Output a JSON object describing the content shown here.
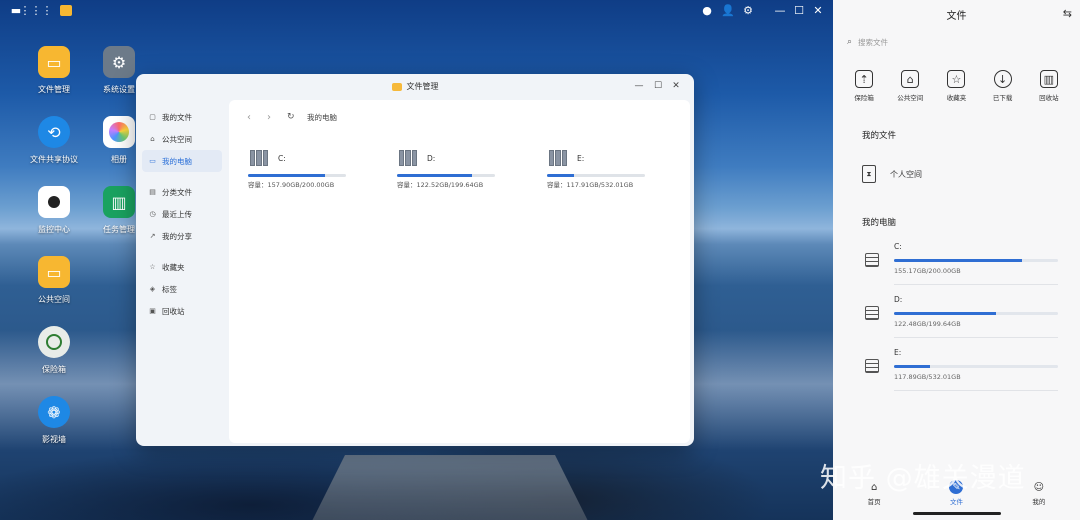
{
  "desktop": {
    "icons": [
      {
        "label": "文件管理",
        "icon": "folder-icon",
        "color": "#f7b731"
      },
      {
        "label": "系统设置",
        "icon": "gear-icon",
        "color": "#6c7a89"
      },
      {
        "label": "文件共享协议",
        "icon": "share-icon",
        "color": "#1e88e5"
      },
      {
        "label": "相册",
        "icon": "photos-icon",
        "color": "#ffffff"
      },
      {
        "label": "监控中心",
        "icon": "camera-icon",
        "color": "#ffffff"
      },
      {
        "label": "任务管理",
        "icon": "task-icon",
        "color": "#1aa260"
      },
      {
        "label": "公共空间",
        "icon": "public-folder-icon",
        "color": "#f7b731"
      },
      {
        "label": "保险箱",
        "icon": "safe-icon",
        "color": "#e8ece8"
      },
      {
        "label": "影视墙",
        "icon": "video-icon",
        "color": "#1e88e5"
      }
    ]
  },
  "window": {
    "title": "文件管理",
    "sidebar": [
      {
        "label": "我的文件",
        "icon": "my-files-icon"
      },
      {
        "label": "公共空间",
        "icon": "public-space-icon"
      },
      {
        "label": "我的电脑",
        "icon": "computer-icon",
        "active": true
      },
      {
        "label": "分类文件",
        "icon": "category-icon"
      },
      {
        "label": "最近上传",
        "icon": "recent-upload-icon"
      },
      {
        "label": "我的分享",
        "icon": "share-icon"
      },
      {
        "label": "收藏夹",
        "icon": "star-icon"
      },
      {
        "label": "标签",
        "icon": "tag-icon"
      },
      {
        "label": "回收站",
        "icon": "trash-icon"
      }
    ],
    "path": "我的电脑",
    "drives": [
      {
        "name": "C:",
        "capacity": "容量：157.90GB/200.00GB",
        "fraction": 0.79
      },
      {
        "name": "D:",
        "capacity": "容量：122.52GB/199.64GB",
        "fraction": 0.77
      },
      {
        "name": "E:",
        "capacity": "容量：117.91GB/532.01GB",
        "fraction": 0.28
      }
    ]
  },
  "panel": {
    "title": "文件",
    "search_placeholder": "搜索文件",
    "quick": [
      {
        "label": "保险箱",
        "icon": "safe-icon"
      },
      {
        "label": "公共空间",
        "icon": "public-folder-icon"
      },
      {
        "label": "收藏夹",
        "icon": "favorites-icon"
      },
      {
        "label": "已下载",
        "icon": "download-icon"
      },
      {
        "label": "回收站",
        "icon": "trash-icon"
      }
    ],
    "my_files_title": "我的文件",
    "personal_space": "个人空间",
    "my_computer_title": "我的电脑",
    "drives": [
      {
        "name": "C:",
        "capacity": "155.17GB/200.00GB",
        "fraction": 0.78
      },
      {
        "name": "D:",
        "capacity": "122.48GB/199.64GB",
        "fraction": 0.62
      },
      {
        "name": "E:",
        "capacity": "117.89GB/532.01GB",
        "fraction": 0.22
      }
    ],
    "bottom_tabs": [
      {
        "label": "首页",
        "icon": "home-icon"
      },
      {
        "label": "文件",
        "icon": "files-icon",
        "active": true
      },
      {
        "label": "我的",
        "icon": "profile-icon"
      }
    ]
  },
  "watermark": "知乎 @雄关漫道"
}
